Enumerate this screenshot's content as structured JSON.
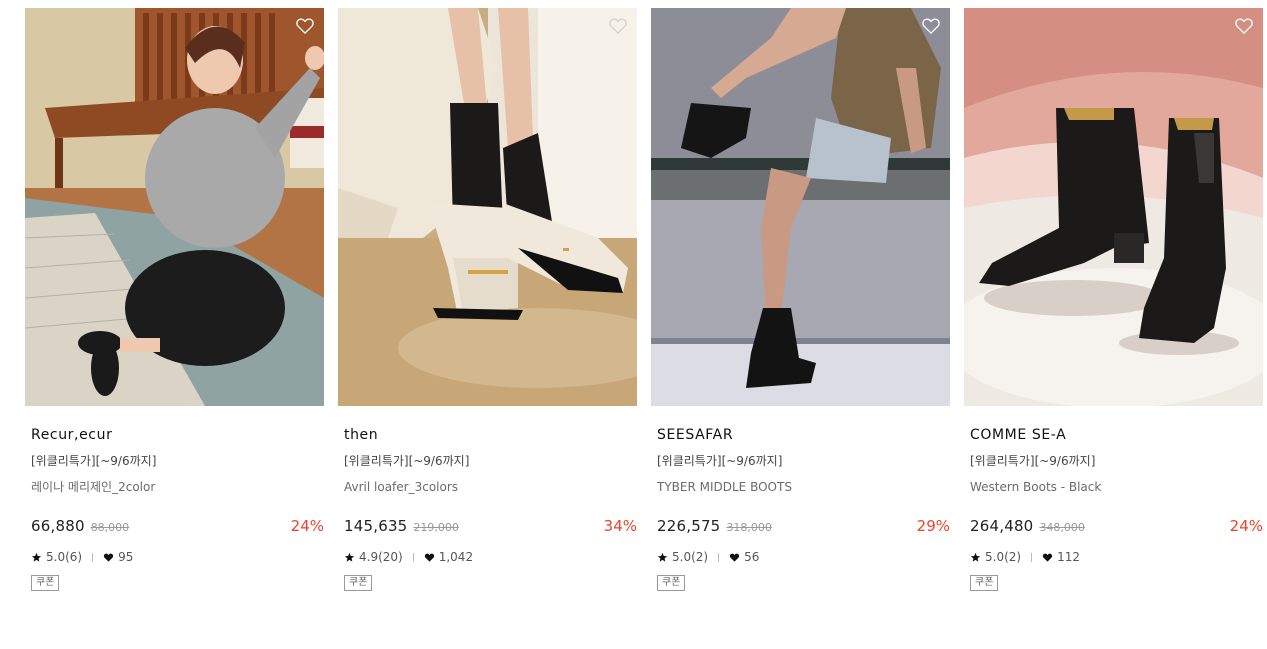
{
  "products": [
    {
      "brand": "Recur,ecur",
      "tag": "[위클리특가][~9/6까지]",
      "name": "레이나 메리제인_2color",
      "price": "66,880",
      "original_price": "88,000",
      "discount": "24%",
      "rating": "5.0(6)",
      "likes": "95",
      "coupon": "쿠폰"
    },
    {
      "brand": "then",
      "tag": "[위클리특가][~9/6까지]",
      "name": "Avril loafer_3colors",
      "price": "145,635",
      "original_price": "219,000",
      "discount": "34%",
      "rating": "4.9(20)",
      "likes": "1,042",
      "coupon": "쿠폰"
    },
    {
      "brand": "SEESAFAR",
      "tag": "[위클리특가][~9/6까지]",
      "name": "TYBER MIDDLE BOOTS",
      "price": "226,575",
      "original_price": "318,000",
      "discount": "29%",
      "rating": "5.0(2)",
      "likes": "56",
      "coupon": "쿠폰"
    },
    {
      "brand": "COMME SE-A",
      "tag": "[위클리특가][~9/6까지]",
      "name": "Western Boots - Black",
      "price": "264,480",
      "original_price": "348,000",
      "discount": "24%",
      "rating": "5.0(2)",
      "likes": "112",
      "coupon": "쿠폰"
    }
  ],
  "colors": {
    "discount": "#e8442a",
    "text": "#222222",
    "muted": "#999999"
  },
  "icons": {
    "wish": "heart-outline-icon",
    "rating": "star-icon",
    "likes": "heart-filled-icon"
  }
}
